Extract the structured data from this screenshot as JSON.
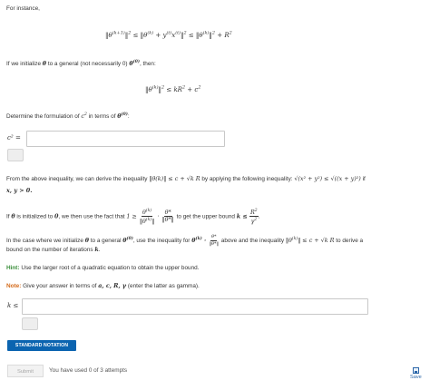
{
  "intro": "For instance,",
  "equation1": "‖θ(k+1)‖² ≤ ‖θ(k) + y(t)x(t)‖² ≤ ‖θ(k)‖² + R²",
  "init_sentence_a": "If we initialize ",
  "init_sentence_b": " to a general (not necessarily 0) ",
  "init_sentence_c": ", then:",
  "equation2": "‖θ(k)‖² ≤ kR² + c²",
  "determine_a": "Determine the formulation of ",
  "determine_b": " in terms of ",
  "determine_c": ":",
  "c2_label": "c² =",
  "c2_input_value": "",
  "inequality_a": "From the above inequality, we can derive the inequality ",
  "inequality_math": "‖θ(k)‖ ≤ c + √k R",
  "inequality_b": " by applying the following inequality: ",
  "inequality_math2": "√(x² + y²) ≤ √((x + y)²)",
  "inequality_c": " if",
  "inequality_d": "x, y > 0.",
  "zero_a": "If ",
  "zero_b": " is initialized to ",
  "zero_c": ", we then use the fact that ",
  "zero_d": " to get the upper bound ",
  "general_a": "In the case where we initialize ",
  "general_b": " to a general ",
  "general_c": ", use the inequality for ",
  "general_d": " above and the inequality ",
  "general_e": " to derive a",
  "general_f": "bound on the number of iterations ",
  "general_g": ".",
  "hint_label": "Hint:",
  "hint_text": " Use the larger root of a quadratic equation to obtain the upper bound.",
  "note_label": "Note:",
  "note_text_a": " Give your answer in terms of ",
  "note_vars": "a, c, R, γ",
  "note_text_b": " (enter the latter as ",
  "note_gamma": "gamma",
  "note_text_c": ").",
  "k_label": "k ≤",
  "k_input_value": "",
  "standard_notation": "STANDARD NOTATION",
  "submit_label": "Submit",
  "attempts_text": "You have used 0 of 3 attempts",
  "save_label": "Save"
}
